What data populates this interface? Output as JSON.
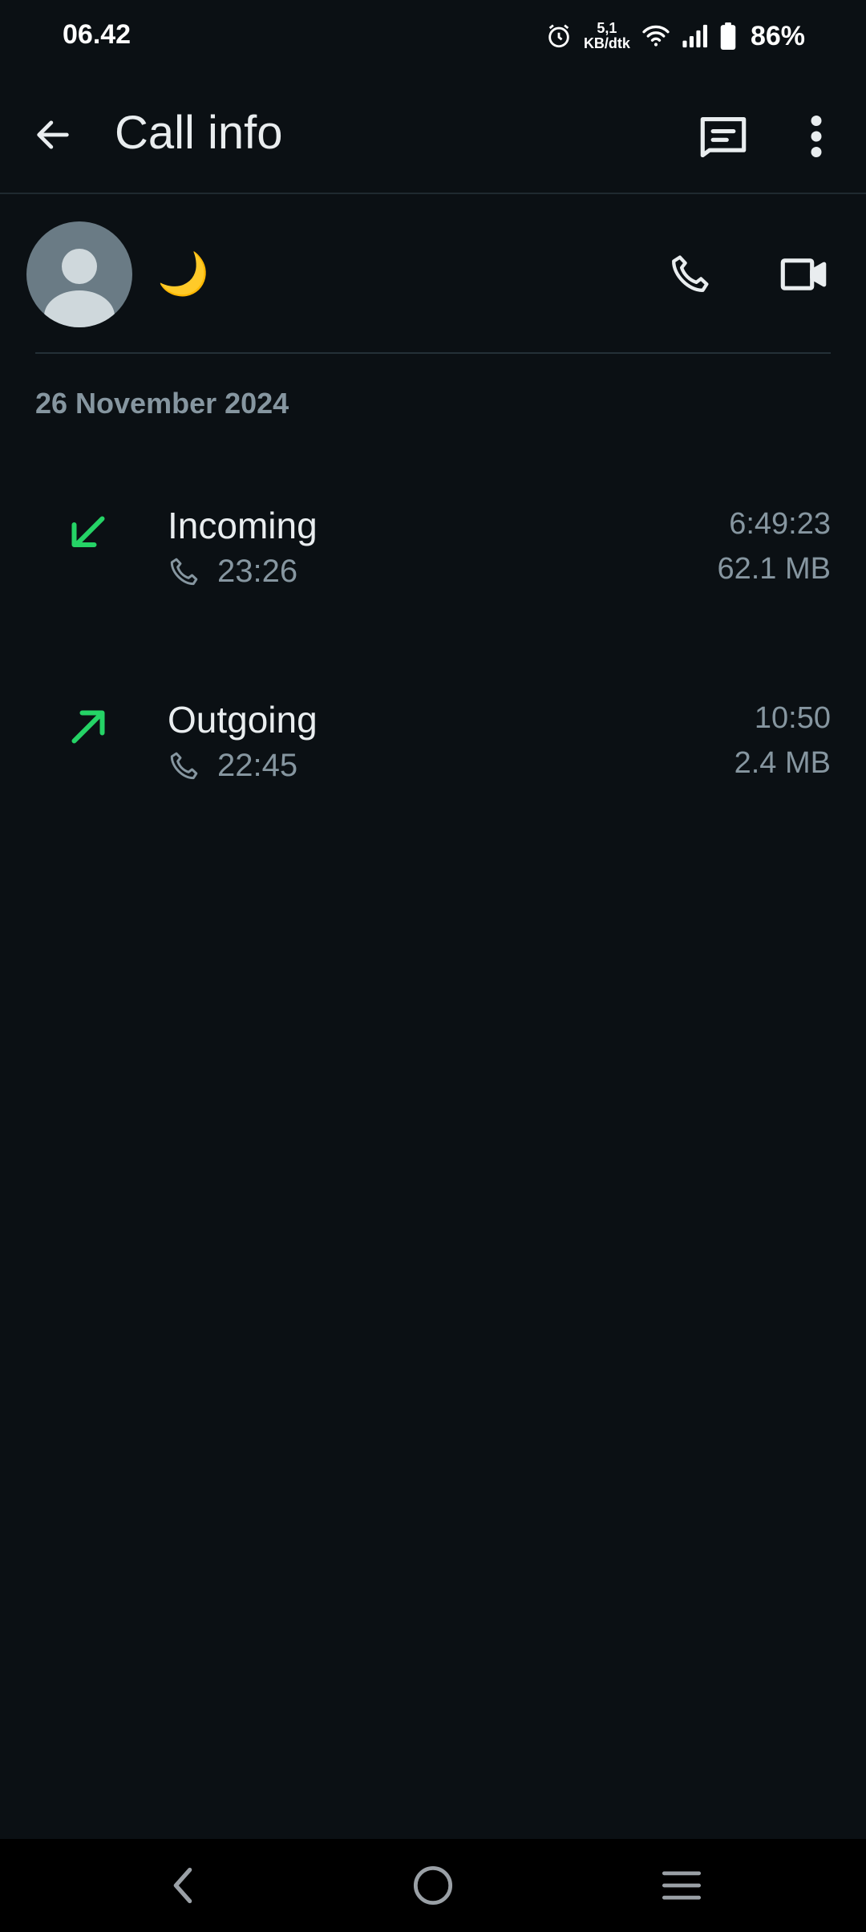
{
  "status_bar": {
    "time": "06.42",
    "speed_value": "5,1",
    "speed_unit": "KB/dtk",
    "battery": "86%"
  },
  "app_bar": {
    "title": "Call info"
  },
  "contact": {
    "name": "🌙"
  },
  "date_header": "26 November 2024",
  "calls": [
    {
      "type": "Incoming",
      "time": "23:26",
      "duration": "6:49:23",
      "data": "62.1 MB",
      "direction": "incoming"
    },
    {
      "type": "Outgoing",
      "time": "22:45",
      "duration": "10:50",
      "data": "2.4 MB",
      "direction": "outgoing"
    }
  ],
  "colors": {
    "background": "#0b1014",
    "text_primary": "#e9edef",
    "text_secondary": "#8696a0",
    "accent_green": "#25d366"
  }
}
